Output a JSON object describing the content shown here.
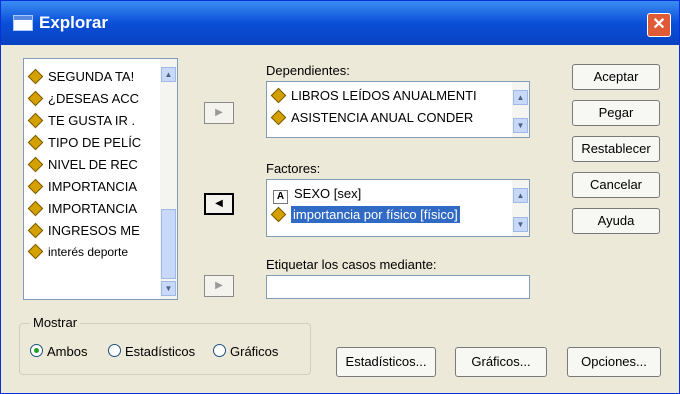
{
  "title": "Explorar",
  "variables": [
    "SEGUNDA TA!",
    "¿DESEAS ACC",
    "TE GUSTA IR .",
    "TIPO DE PELÍC",
    "NIVEL DE REC",
    "IMPORTANCIA",
    "IMPORTANCIA",
    "INGRESOS ME",
    "interés deporte"
  ],
  "dependientes": {
    "label": "Dependientes:",
    "items": [
      "LIBROS LEÍDOS ANUALMENTI",
      "ASISTENCIA ANUAL CONDER"
    ]
  },
  "factores": {
    "label": "Factores:",
    "items": [
      "SEXO [sex]",
      "importancia por físico [físico]"
    ]
  },
  "etiquetar": {
    "label": "Etiquetar los casos mediante:",
    "value": ""
  },
  "buttons": {
    "aceptar": "Aceptar",
    "pegar": "Pegar",
    "restablecer": "Restablecer",
    "cancelar": "Cancelar",
    "ayuda": "Ayuda",
    "estadisticos": "Estadísticos...",
    "graficos": "Gráficos...",
    "opciones": "Opciones..."
  },
  "mostrar": {
    "label": "Mostrar",
    "options": [
      "Ambos",
      "Estadísticos",
      "Gráficos"
    ],
    "selected": "Ambos"
  },
  "arrows": {
    "right": "▶",
    "left": "◀",
    "up": "▲",
    "down": "▼",
    "close": "✕"
  }
}
